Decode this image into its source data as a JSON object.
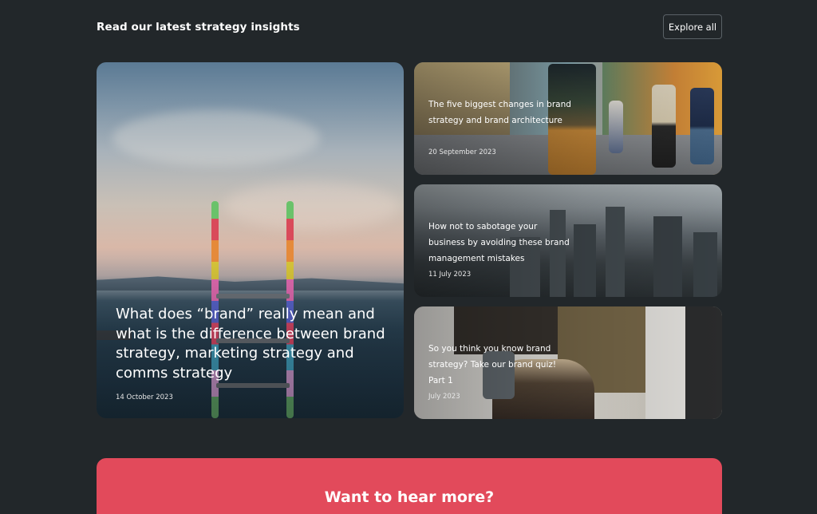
{
  "section": {
    "title": "Read our latest strategy insights",
    "explore_label": "Explore all"
  },
  "cards": {
    "feature": {
      "title": "What does “brand” really mean and what is the difference between brand strategy, marketing strategy and comms strategy",
      "date": "14 October 2023"
    },
    "card1": {
      "title": "The five biggest changes in brand strategy and brand architecture",
      "date": "20 September 2023"
    },
    "card2": {
      "title": "How not to sabotage your business by avoiding these brand management mistakes",
      "date": "11 July 2023"
    },
    "card3": {
      "title": "So you think you know brand strategy? Take our brand quiz! Part 1",
      "date": "July 2023"
    }
  },
  "cta": {
    "title": "Want to hear more?"
  },
  "colors": {
    "background": "#22272a",
    "cta": "#e24a5b"
  }
}
